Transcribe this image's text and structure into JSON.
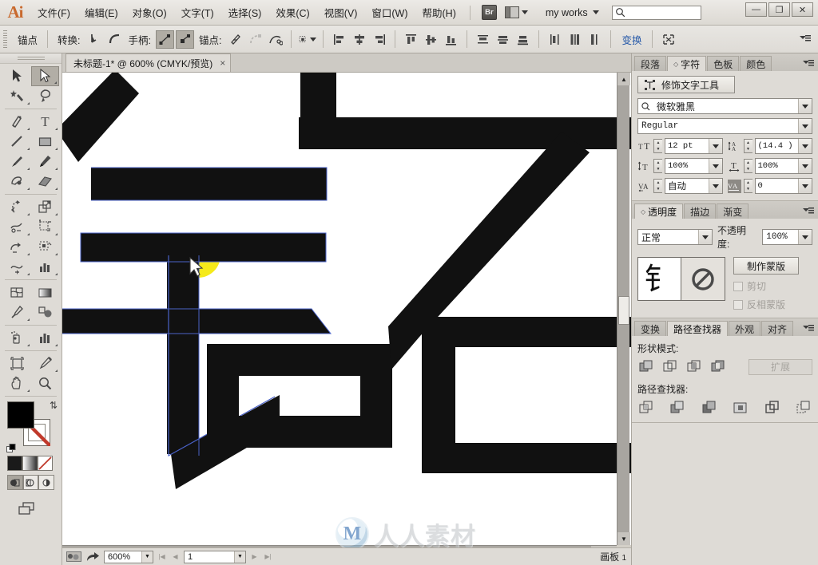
{
  "app": {
    "logo": "Ai",
    "workspace": "my works",
    "search_placeholder": "",
    "search_value": ""
  },
  "menubar": {
    "items": [
      {
        "label": "文件(F)"
      },
      {
        "label": "编辑(E)"
      },
      {
        "label": "对象(O)"
      },
      {
        "label": "文字(T)"
      },
      {
        "label": "选择(S)"
      },
      {
        "label": "效果(C)"
      },
      {
        "label": "视图(V)"
      },
      {
        "label": "窗口(W)"
      },
      {
        "label": "帮助(H)"
      }
    ],
    "bridge_label": "Br"
  },
  "window_controls": {
    "minimize": "—",
    "maximize": "❐",
    "close": "✕"
  },
  "control_bar": {
    "title": "锚点",
    "convert_label": "转换:",
    "handles_label": "手柄:",
    "anchor_label": "锚点:",
    "transform_link": "变换",
    "icons": [
      "convert-to-corner-icon",
      "convert-to-smooth-icon",
      "show-handles-icon",
      "hide-handles-icon",
      "remove-anchor-icon",
      "connect-anchor-icon",
      "cut-path-icon",
      "isolate-selected-icon",
      "align-left-icon",
      "align-horizontal-center-icon",
      "align-right-icon",
      "align-top-icon",
      "align-vertical-center-icon",
      "align-bottom-icon",
      "distribute-top-icon",
      "distribute-vcenter-icon",
      "distribute-bottom-icon",
      "distribute-left-icon",
      "distribute-hcenter-icon",
      "distribute-right-icon",
      "envelope-distort-icon"
    ]
  },
  "tools": {
    "items": [
      {
        "name": "selection-tool",
        "glyph": "➤",
        "active": false
      },
      {
        "name": "direct-selection-tool",
        "glyph": "➤",
        "active": true
      },
      {
        "name": "magic-wand-tool",
        "glyph": "✳",
        "active": false
      },
      {
        "name": "lasso-tool",
        "glyph": "◠",
        "active": false
      },
      {
        "name": "pen-tool",
        "glyph": "✒",
        "active": false
      },
      {
        "name": "type-tool",
        "glyph": "T",
        "active": false
      },
      {
        "name": "line-segment-tool",
        "glyph": "／",
        "active": false
      },
      {
        "name": "rectangle-tool",
        "glyph": "▭",
        "active": false
      },
      {
        "name": "paintbrush-tool",
        "glyph": "🖌",
        "active": false
      },
      {
        "name": "pencil-tool",
        "glyph": "✎",
        "active": false
      },
      {
        "name": "blob-brush-tool",
        "glyph": "◖",
        "active": false
      },
      {
        "name": "eraser-tool",
        "glyph": "▰",
        "active": false
      },
      {
        "name": "rotate-tool",
        "glyph": "↻",
        "active": false
      },
      {
        "name": "scale-tool",
        "glyph": "⤢",
        "active": false
      },
      {
        "name": "width-tool",
        "glyph": "⋈",
        "active": false
      },
      {
        "name": "free-transform-tool",
        "glyph": "⬚",
        "active": false
      },
      {
        "name": "shape-builder-tool",
        "glyph": "◕",
        "active": false
      },
      {
        "name": "graph-tool",
        "glyph": "▥",
        "active": false
      },
      {
        "name": "mesh-tool",
        "glyph": "▨",
        "active": false
      },
      {
        "name": "gradient-tool",
        "glyph": "▤",
        "active": false
      },
      {
        "name": "eyedropper-tool",
        "glyph": "⚲",
        "active": false
      },
      {
        "name": "blend-tool",
        "glyph": "◓",
        "active": false
      },
      {
        "name": "symbol-sprayer-tool",
        "glyph": "⛲",
        "active": false
      },
      {
        "name": "column-graph-tool",
        "glyph": "▥",
        "active": false
      },
      {
        "name": "artboard-tool",
        "glyph": "⬜",
        "active": false
      },
      {
        "name": "slice-tool",
        "glyph": "✂",
        "active": false
      },
      {
        "name": "hand-tool",
        "glyph": "✋",
        "active": false
      },
      {
        "name": "zoom-tool",
        "glyph": "🔍",
        "active": false
      }
    ],
    "fill_color": "#000000",
    "stroke_color": "none",
    "color_modes": [
      "color-swatch-mode",
      "gradient-mode",
      "none-mode"
    ],
    "draw_modes": [
      "draw-normal",
      "draw-behind",
      "draw-inside"
    ],
    "screen_mode": "change-screen-mode"
  },
  "document": {
    "tab_title": "未标题-1* @ 600% (CMYK/预览)",
    "close_glyph": "×"
  },
  "statusbar": {
    "zoom": "600%",
    "page": "1",
    "artboard_label": "画板",
    "artboard_number": "1"
  },
  "character_panel": {
    "tabs": [
      {
        "label": "段落",
        "active": false
      },
      {
        "label": "字符",
        "active": true
      },
      {
        "label": "色板",
        "active": false
      },
      {
        "label": "颜色",
        "active": false
      }
    ],
    "touch_type_button": "修饰文字工具",
    "font_family": "微软雅黑",
    "font_style": "Regular",
    "font_size": "12 pt",
    "leading": "(14.4 )",
    "vertical_scale": "100%",
    "horizontal_scale": "100%",
    "kerning": "自动",
    "tracking": "0"
  },
  "transparency_panel": {
    "tabs": [
      {
        "label": "透明度",
        "active": true
      },
      {
        "label": "描边",
        "active": false
      },
      {
        "label": "渐变",
        "active": false
      }
    ],
    "blend_mode": "正常",
    "opacity_label": "不透明度:",
    "opacity_value": "100%",
    "make_mask_button": "制作蒙版",
    "clip_label": "剪切",
    "invert_mask_label": "反相蒙版",
    "thumbnail_glyph": "钅"
  },
  "pathfinder_panel": {
    "tabs": [
      {
        "label": "变换",
        "active": false
      },
      {
        "label": "路径查找器",
        "active": true
      },
      {
        "label": "外观",
        "active": false
      },
      {
        "label": "对齐",
        "active": false
      }
    ],
    "shape_modes_label": "形状模式:",
    "expand_button": "扩展",
    "pathfinders_label": "路径查找器:",
    "shape_mode_icons": [
      "unite-icon",
      "minus-front-icon",
      "intersect-icon",
      "exclude-icon"
    ],
    "pathfinder_icons": [
      "divide-icon",
      "trim-icon",
      "merge-icon",
      "crop-icon",
      "outline-icon",
      "minus-back-icon"
    ]
  },
  "canvas": {
    "artwork_description": "钅 stroke glyph artwork with selected path",
    "selection_color": "#4a62c8",
    "highlight_color": "#f5ea1a",
    "artboard_background": "#ffffff"
  },
  "watermark": {
    "logo_letter": "M",
    "text": "人人素材"
  }
}
